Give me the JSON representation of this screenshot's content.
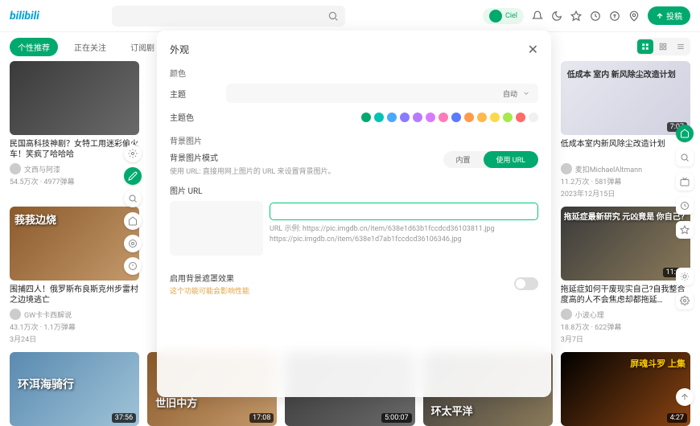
{
  "header": {
    "logo": "bilibili",
    "avatar_name": "Ciel",
    "upload_label": "投稿"
  },
  "tabs": {
    "items": [
      "个性推荐",
      "正在关注",
      "订阅剧"
    ],
    "active_index": 0
  },
  "modal": {
    "title": "外观",
    "sections": {
      "color": {
        "label": "颜色",
        "theme_label": "主题",
        "theme_value": "自动",
        "theme_color_label": "主题色",
        "colors": [
          "#00a96e",
          "#00c4b4",
          "#4aa8ff",
          "#8a7aff",
          "#b87aff",
          "#d87aff",
          "#ff7ab8",
          "#5a7aff",
          "#ff9a4a",
          "#ffb84a",
          "#ffd84a",
          "#a8e84a",
          "#ff6a6a",
          "#f0f0f0"
        ]
      },
      "bg": {
        "label": "背景图片",
        "mode_label": "背景图片模式",
        "mode_desc": "使用 URL: 直接用网上图片的 URL 来设置背景图片。",
        "mode_opts": [
          "内置",
          "使用 URL"
        ],
        "url_label": "图片 URL",
        "url_hint1": "URL 示例: https://pic.imgdb.cn/item/638e1d63b1fccdcd36103811.jpg",
        "url_hint2": "https://pic.imgdb.cn/item/638e1d7ab1fccdcd36106346.jpg"
      },
      "mask": {
        "label": "启用背景遮罩效果",
        "warn": "这个功能可能会影响性能"
      }
    }
  },
  "cards": [
    {
      "title": "民国高科技神剧？女特工用迷彩偷火车！笑疯了哈哈哈",
      "author": "文西与阿漆",
      "stats": "54.5万次 · 4977弹幕",
      "date": "",
      "duration": "",
      "overlay": ""
    },
    {
      "title": "低成本室内新风除尘改造计划",
      "author": "麦扣MichaelAltmann",
      "stats": "11.2万次 · 581弹幕",
      "date": "2023年12月15日",
      "duration": "7:07",
      "overlay": "低成本 室内\n新风除尘改造计划"
    },
    {
      "title": "围捕四人！俄罗斯布良斯克州步雷村之边境逃亡",
      "author": "GW卡卡西解说",
      "stats": "43.1万次 · 1.1万弹幕",
      "date": "3月24日",
      "duration": "",
      "overlay": "莪莪边烧"
    },
    {
      "title": "拖延症如何干废现实自己?自我整合度高的人不会焦虑却都拖延…",
      "author": "小波心理",
      "stats": "18.8万次 · 622弹幕",
      "date": "3月7日",
      "duration": "11:40",
      "overlay": "拖延症最新研究\n元凶竟是\n你自己?"
    },
    {
      "title": "",
      "author": "",
      "stats": "",
      "date": "",
      "duration": "37:56",
      "overlay": "环洱海骑行"
    },
    {
      "title": "",
      "author": "",
      "stats": "",
      "date": "",
      "duration": "17:08",
      "overlay": "世旧中方"
    },
    {
      "title": "",
      "author": "",
      "stats": "",
      "date": "",
      "duration": "5:00:07",
      "overlay": ""
    },
    {
      "title": "",
      "author": "",
      "stats": "",
      "date": "",
      "duration": "",
      "overlay": "环太平洋"
    },
    {
      "title": "",
      "author": "",
      "stats": "",
      "date": "",
      "duration": "4:27",
      "overlay": "屏魂斗罗\n上集"
    }
  ]
}
